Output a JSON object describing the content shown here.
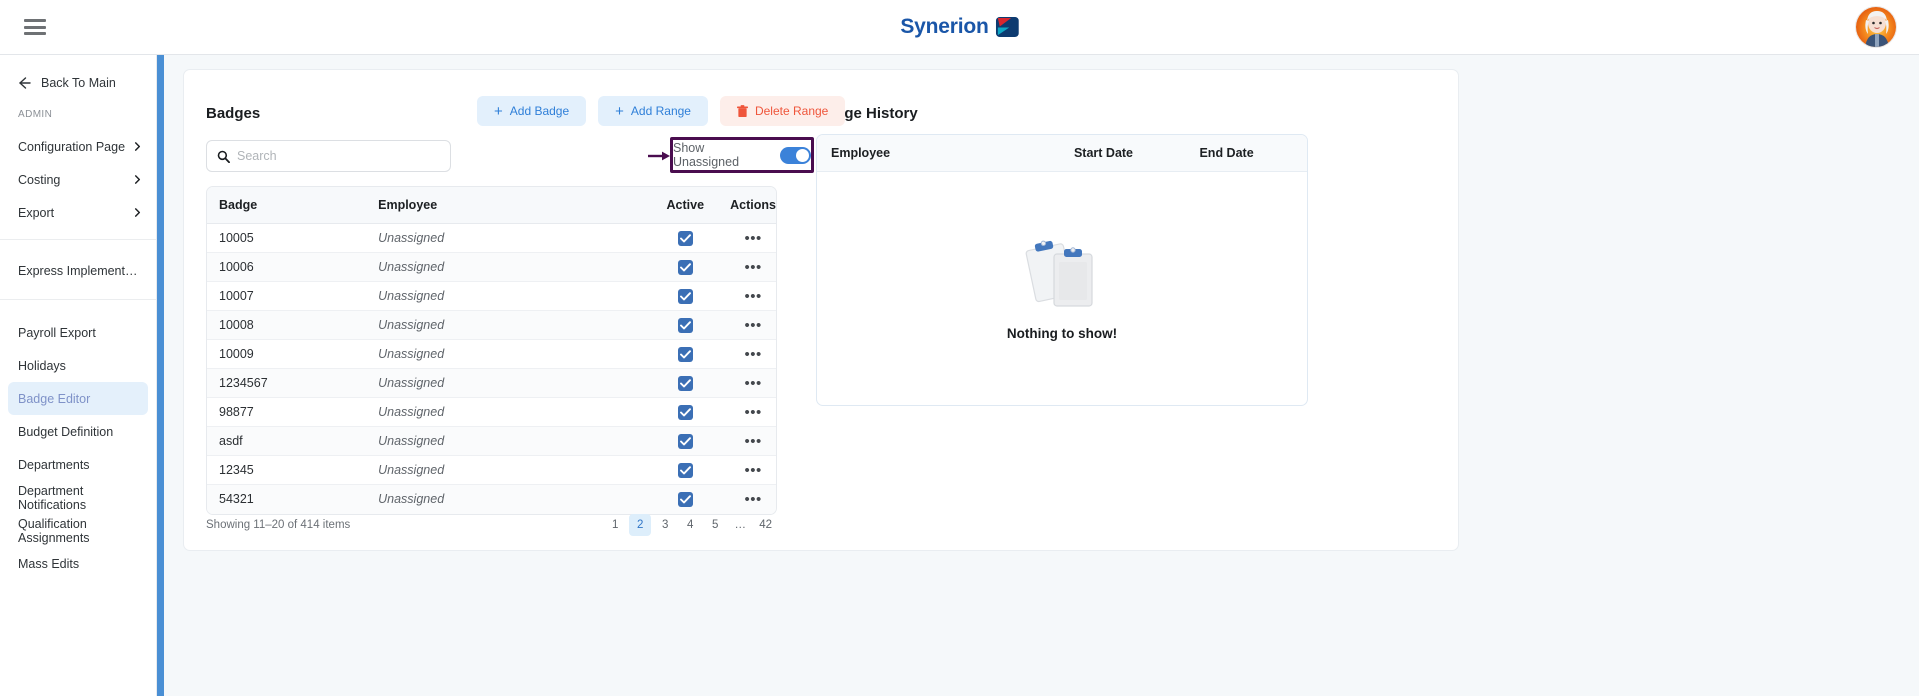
{
  "topbar": {
    "menu_icon": "hamburger-icon",
    "brand_name": "Synerion",
    "avatar_alt": "user-avatar"
  },
  "sidebar": {
    "back_label": "Back To Main",
    "section_label": "ADMIN",
    "group_expandable": [
      {
        "label": "Configuration Page",
        "has_chevron": true
      },
      {
        "label": "Costing",
        "has_chevron": true
      },
      {
        "label": "Export",
        "has_chevron": true
      }
    ],
    "group_single": [
      {
        "label": "Express Implementation P…"
      }
    ],
    "group_pages": [
      {
        "label": "Payroll Export",
        "active": false
      },
      {
        "label": "Holidays",
        "active": false
      },
      {
        "label": "Badge Editor",
        "active": true
      },
      {
        "label": "Budget Definition",
        "active": false
      },
      {
        "label": "Departments",
        "active": false
      },
      {
        "label": "Department Notifications",
        "active": false
      },
      {
        "label": "Qualification Assignments",
        "active": false
      },
      {
        "label": "Mass Edits",
        "active": false
      }
    ]
  },
  "badges_panel": {
    "title": "Badges",
    "buttons": {
      "add_badge": "Add Badge",
      "add_range": "Add Range",
      "delete_range": "Delete Range"
    },
    "search_placeholder": "Search",
    "search_value": "",
    "toggle_label": "Show Unassigned",
    "toggle_on": true,
    "columns": [
      "Badge",
      "Employee",
      "Active",
      "Actions"
    ],
    "rows": [
      {
        "badge": "10005",
        "employee": "Unassigned",
        "active": true,
        "actions": "•••"
      },
      {
        "badge": "10006",
        "employee": "Unassigned",
        "active": true,
        "actions": "•••"
      },
      {
        "badge": "10007",
        "employee": "Unassigned",
        "active": true,
        "actions": "•••"
      },
      {
        "badge": "10008",
        "employee": "Unassigned",
        "active": true,
        "actions": "•••"
      },
      {
        "badge": "10009",
        "employee": "Unassigned",
        "active": true,
        "actions": "•••"
      },
      {
        "badge": "1234567",
        "employee": "Unassigned",
        "active": true,
        "actions": "•••"
      },
      {
        "badge": "98877",
        "employee": "Unassigned",
        "active": true,
        "actions": "•••"
      },
      {
        "badge": "asdf",
        "employee": "Unassigned",
        "active": true,
        "actions": "•••"
      },
      {
        "badge": "12345",
        "employee": "Unassigned",
        "active": true,
        "actions": "•••"
      },
      {
        "badge": "54321",
        "employee": "Unassigned",
        "active": true,
        "actions": "•••"
      }
    ],
    "footer": {
      "showing": "Showing 11–20 of 414 items",
      "pages": [
        "1",
        "2",
        "3",
        "4",
        "5",
        "…",
        "42"
      ],
      "current_page": "2"
    }
  },
  "history_panel": {
    "title": "Badge History",
    "columns": [
      "Employee",
      "Start Date",
      "End Date"
    ],
    "empty_text": "Nothing to show!",
    "empty_icon": "clipboard-stack-icon",
    "rows": []
  },
  "colors": {
    "accent_blue": "#3b82d9",
    "brand_blue": "#1a56a8",
    "btn_blue_bg": "#e3f0fc",
    "btn_blue_fg": "#2f7fd8",
    "btn_red_bg": "#fdeeea",
    "btn_red_fg": "#ef553b",
    "rail_blue": "#4a8fd4",
    "annotation_purple": "#4a0d4f",
    "page_bg": "#f5f8fa",
    "active_nav_bg": "#e4f0fb"
  }
}
